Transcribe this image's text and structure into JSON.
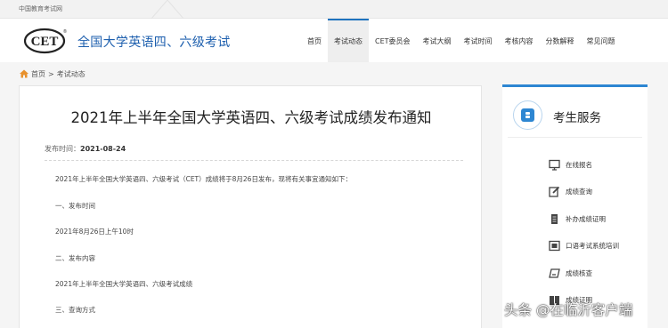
{
  "topbar": {
    "site_name": "中国教育考试网"
  },
  "header": {
    "logo_text": "CET",
    "logo_reg": "®",
    "title": "全国大学英语四、六级考试",
    "nav": [
      {
        "label": "首页",
        "active": false
      },
      {
        "label": "考试动态",
        "active": true
      },
      {
        "label": "CET委员会",
        "active": false
      },
      {
        "label": "考试大纲",
        "active": false
      },
      {
        "label": "考试时间",
        "active": false
      },
      {
        "label": "考核内容",
        "active": false
      },
      {
        "label": "分数解释",
        "active": false
      },
      {
        "label": "常见问题",
        "active": false
      }
    ]
  },
  "breadcrumb": {
    "home": "首页",
    "separator": ">",
    "current": "考试动态"
  },
  "article": {
    "title": "2021年上半年全国大学英语四、六级考试成绩发布通知",
    "meta_label": "发布时间：",
    "meta_date": "2021-08-24",
    "paragraphs": [
      "2021年上半年全国大学英语四、六级考试（CET）成绩将于8月26日发布，现将有关事宜通知如下：",
      "一、发布时间",
      "2021年8月26日上午10时",
      "二、发布内容",
      "2021年上半年全国大学英语四、六级考试成绩",
      "三、查询方式"
    ]
  },
  "sidebar": {
    "title": "考生服务",
    "items": [
      {
        "label": "在线报名",
        "icon": "monitor-icon"
      },
      {
        "label": "成绩查询",
        "icon": "edit-icon"
      },
      {
        "label": "补办成绩证明",
        "icon": "document-icon"
      },
      {
        "label": "口语考试系统培训",
        "icon": "screen-icon"
      },
      {
        "label": "成绩核查",
        "icon": "book-edit-icon"
      },
      {
        "label": "成绩证明",
        "icon": "book-icon"
      }
    ]
  },
  "watermark": "头条 @在临沂客户端",
  "colors": {
    "brand_blue": "#1d5fae",
    "accent_blue": "#2d86d2"
  }
}
